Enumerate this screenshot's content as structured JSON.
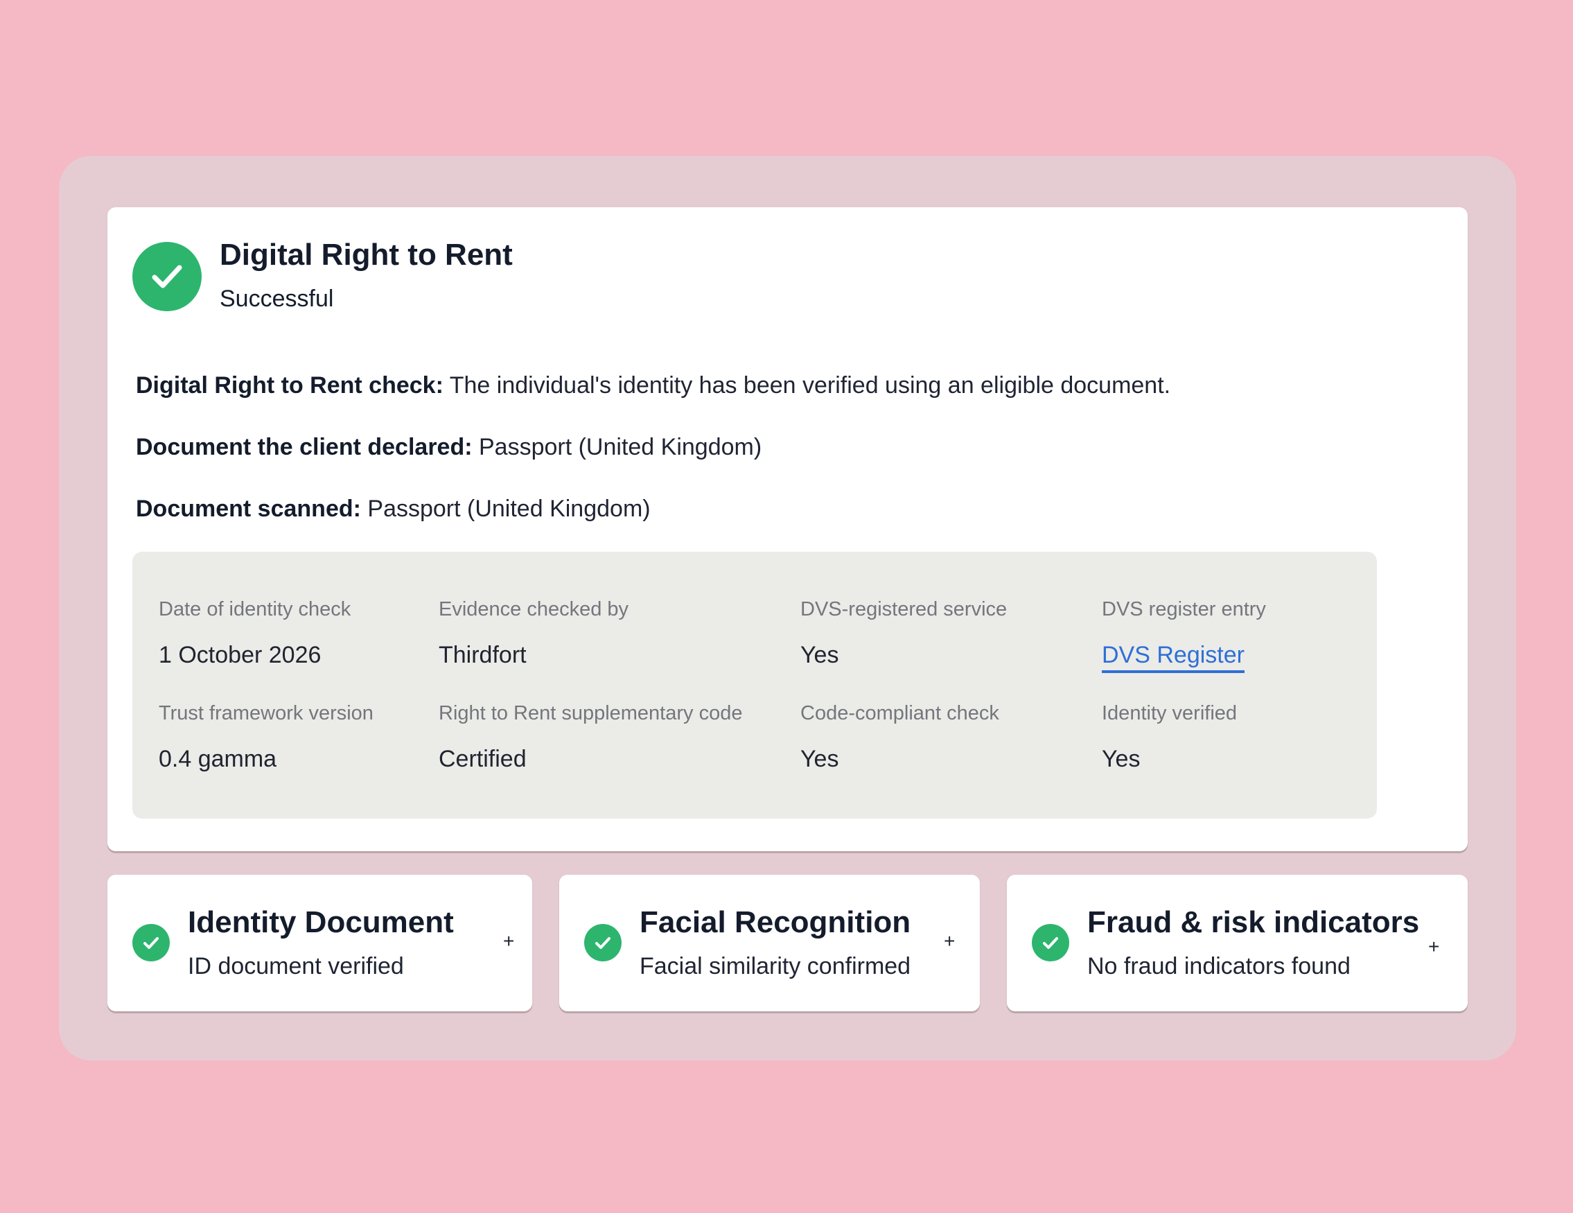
{
  "colors": {
    "background": "#f5b8c5",
    "panel": "#e5ccd2",
    "success": "#2db56e",
    "link": "#2f6fd6",
    "details_bg": "#ebebe8"
  },
  "main": {
    "icon": "check-circle-icon",
    "title": "Digital Right to Rent",
    "status": "Successful",
    "check_label": "Digital Right to Rent check:",
    "check_value": " The individual's identity has been verified using an eligible document.",
    "declared_label": "Document the client declared:",
    "declared_value": " Passport (United Kingdom)",
    "scanned_label": "Document scanned:",
    "scanned_value": " Passport (United Kingdom)"
  },
  "details": {
    "date_label": "Date of identity check",
    "date_value": "1 October 2026",
    "evidence_label": "Evidence checked by",
    "evidence_value": "Thirdfort",
    "dvs_service_label": "DVS-registered service",
    "dvs_service_value": "Yes",
    "dvs_entry_label": "DVS register entry",
    "dvs_entry_link": "DVS Register",
    "trust_label": "Trust framework version",
    "trust_value": "0.4 gamma",
    "supp_label": "Right to Rent supplementary code",
    "supp_value": "Certified",
    "code_label": "Code-compliant check",
    "code_value": "Yes",
    "identity_label": "Identity verified",
    "identity_value": "Yes"
  },
  "cards": [
    {
      "title": "Identity Document",
      "subtitle": "ID document verified",
      "icon": "check-circle-icon",
      "expand": "+"
    },
    {
      "title": "Facial Recognition",
      "subtitle": "Facial similarity confirmed",
      "icon": "check-circle-icon",
      "expand": "+"
    },
    {
      "title": "Fraud & risk indicators",
      "subtitle": "No fraud indicators found",
      "icon": "check-circle-icon",
      "expand": "+"
    }
  ]
}
